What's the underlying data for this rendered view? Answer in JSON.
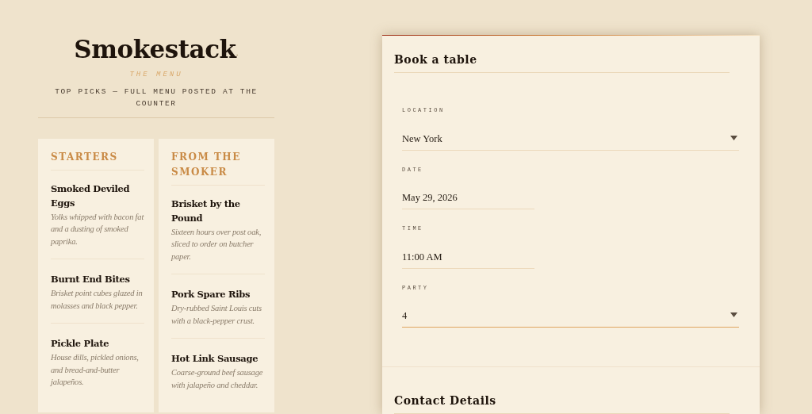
{
  "brand": {
    "name": "Smokestack",
    "mark": "."
  },
  "menu": {
    "eyebrow": "THE MENU",
    "subtitle": "TOP PICKS — FULL MENU POSTED AT THE COUNTER",
    "sections": [
      {
        "title": "STARTERS",
        "items": [
          {
            "name": "Smoked Deviled Eggs",
            "description": "Yolks whipped with bacon fat and a dusting of smoked paprika."
          },
          {
            "name": "Burnt End Bites",
            "description": "Brisket point cubes glazed in molasses and black pepper."
          },
          {
            "name": "Pickle Plate",
            "description": "House dills, pickled onions, and bread-and-butter jalapeños."
          }
        ]
      },
      {
        "title": "FROM THE SMOKER",
        "items": [
          {
            "name": "Brisket by the Pound",
            "description": "Sixteen hours over post oak, sliced to order on butcher paper."
          },
          {
            "name": "Pork Spare Ribs",
            "description": "Dry-rubbed Saint Louis cuts with a black-pepper crust."
          },
          {
            "name": "Hot Link Sausage",
            "description": "Coarse-ground beef sausage with jalapeño and cheddar."
          }
        ]
      }
    ]
  },
  "booking": {
    "title": "Book a table",
    "fields": [
      {
        "kind": "select",
        "label": "LOCATION",
        "value": "New York",
        "focused": false
      },
      {
        "kind": "text",
        "label": "DATE",
        "value": "May 29, 2026",
        "focused": false
      },
      {
        "kind": "text",
        "label": "TIME",
        "value": "11:00 AM",
        "focused": false
      },
      {
        "kind": "select",
        "label": "PARTY",
        "value": "4",
        "focused": true
      }
    ],
    "contact_title": "Contact Details"
  }
}
